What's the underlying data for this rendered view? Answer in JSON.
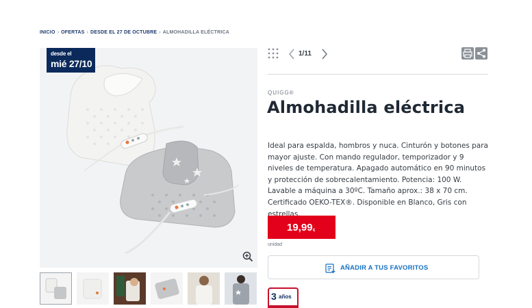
{
  "breadcrumb": {
    "items": [
      "INICIO",
      "OFERTAS",
      "DESDE EL 27 DE OCTUBRE"
    ],
    "current": "ALMOHADILLA ELÉCTRICA",
    "separator": "›"
  },
  "badge": {
    "line1": "desde el",
    "line2": "mié 27/10"
  },
  "gallery": {
    "zoom_icon": "zoom-in-icon",
    "thumbnail_count": 6
  },
  "toolbar": {
    "pager": "1/11",
    "icons": [
      "grid-icon",
      "chevron-left-icon",
      "chevron-right-icon",
      "print-icon",
      "share-icon"
    ]
  },
  "product": {
    "brand": "QUIGG®",
    "title": "Almohadilla eléctrica",
    "description": "Ideal para espalda, hombros y nuca. Cinturón y botones para mayor ajuste. Con mando regulador, temporizador y 9 niveles de temperatura. Apagado automático en 90 minutos y protección de sobrecalentamiento. Potencia: 100 W. Lavable a máquina a 30ºC. Tamaño aprox.: 38 x 70 cm. Certificado OEKO-TEX®. Disponible en Blanco, Gris con estrellas.",
    "price": "19,99",
    "currency": "€",
    "unit": "unidad"
  },
  "favorites": {
    "label": "AÑADIR A TUS FAVORITOS",
    "icon": "add-to-list-icon"
  },
  "warranty": {
    "number": "3",
    "text": "años"
  },
  "colors": {
    "navy": "#0b2a5b",
    "price_red": "#e2001a",
    "link_blue": "#1670c2"
  }
}
